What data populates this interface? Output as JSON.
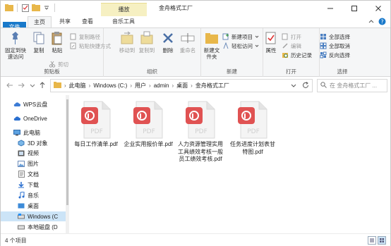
{
  "window": {
    "title": "金舟格式工厂",
    "context_tab": "播放"
  },
  "tabs": {
    "file": "文件",
    "home": "主页",
    "share": "共享",
    "view": "查看",
    "music_tools": "音乐工具"
  },
  "ribbon": {
    "clipboard": {
      "label": "剪贴板",
      "pin": "固定到快速访问",
      "copy": "复制",
      "paste": "粘贴",
      "cut": "剪切",
      "copy_path": "复制路径",
      "paste_shortcut": "粘贴快捷方式"
    },
    "organize": {
      "label": "组织",
      "move_to": "移动到",
      "copy_to": "复制到",
      "delete": "删除",
      "rename": "重命名"
    },
    "new": {
      "label": "新建",
      "new_folder": "新建文件夹",
      "new_item": "新建项目",
      "easy_access": "轻松访问"
    },
    "open": {
      "label": "打开",
      "properties": "属性",
      "open": "打开",
      "edit": "编辑",
      "history": "历史记录"
    },
    "select": {
      "label": "选择",
      "select_all": "全部选择",
      "select_none": "全部取消",
      "invert": "反向选择"
    }
  },
  "address": {
    "crumbs": [
      "此电脑",
      "Windows (C:)",
      "用户",
      "admin",
      "桌面",
      "金舟格式工厂"
    ],
    "search_placeholder": "在 金舟格式工厂 ..."
  },
  "navpane": {
    "items": [
      {
        "label": "WPS云盘",
        "icon": "cloud-icon"
      },
      {
        "label": "OneDrive",
        "icon": "cloud-icon"
      },
      {
        "label": "此电脑",
        "icon": "computer-icon"
      },
      {
        "label": "3D 对象",
        "icon": "cube-icon"
      },
      {
        "label": "视频",
        "icon": "video-icon"
      },
      {
        "label": "图片",
        "icon": "picture-icon"
      },
      {
        "label": "文档",
        "icon": "document-icon"
      },
      {
        "label": "下载",
        "icon": "download-icon"
      },
      {
        "label": "音乐",
        "icon": "music-icon"
      },
      {
        "label": "桌面",
        "icon": "desktop-icon"
      },
      {
        "label": "Windows (C",
        "icon": "drive-icon"
      },
      {
        "label": "本地磁盘 (D",
        "icon": "drive-icon"
      }
    ]
  },
  "files": [
    {
      "name": "每日工作清单.pdf",
      "type": "PDF"
    },
    {
      "name": "企业实用报价单.pdf",
      "type": "PDF"
    },
    {
      "name": "人力资源管理实用工具绩效考核一般员工绩效考核.pdf",
      "type": "PDF"
    },
    {
      "name": "任务进度计划表甘特图.pdf",
      "type": "PDF"
    }
  ],
  "status": {
    "count": "4 个项目"
  },
  "colors": {
    "accent": "#1979ca",
    "pdf_badge": "#e05252",
    "context_tab_bg": "#f6f0c2",
    "selection": "#cce4f7"
  }
}
